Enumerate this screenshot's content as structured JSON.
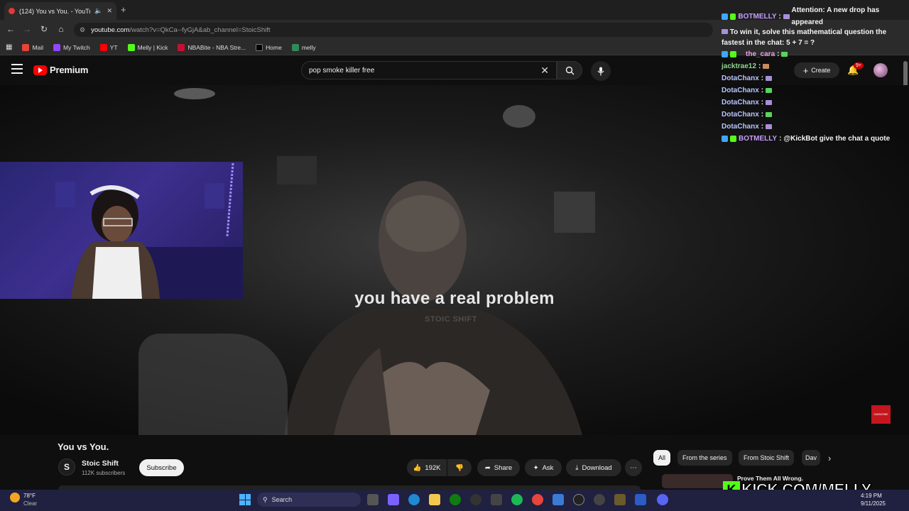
{
  "browser": {
    "tab_title": "(124) You vs You. - YouTube",
    "url_host": "youtube.com",
    "url_path": "/watch?v=QkCa--fyGjA&ab_channel=StoicShift",
    "bookmarks": [
      "Mail",
      "My Twitch",
      "YT",
      "Melly | Kick",
      "NBABite - NBA Stre...",
      "Home",
      "melly"
    ]
  },
  "youtube": {
    "logo_text": "Premium",
    "search_query": "pop smoke killer free",
    "create_label": "Create",
    "notif_count": "9+"
  },
  "video": {
    "caption": "you have a real problem",
    "watermark": "STOIC SHIFT",
    "subscribe_overlay": "SUBSCRIBE",
    "title": "You vs You.",
    "channel_initial": "S",
    "channel_name": "Stoic Shift",
    "subscribers": "112K subscribers",
    "subscribe_label": "Subscribe",
    "likes": "192K",
    "share_label": "Share",
    "ask_label": "Ask",
    "download_label": "Download"
  },
  "chips": [
    "All",
    "From the series",
    "From Stoic Shift",
    "Dav"
  ],
  "recommendation": {
    "title": "Prove Them All Wrong."
  },
  "chat": [
    {
      "user": "BOTMELLY",
      "text": "Attention: A new drop has appeared",
      "text2": "To win it, solve this mathematical question the fastest in the chat: 5 + 7 = ?"
    },
    {
      "user": "the_cara",
      "text": ""
    },
    {
      "user": "jacktrae12",
      "text": ""
    },
    {
      "user": "DotaChanx",
      "text": ""
    },
    {
      "user": "DotaChanx",
      "text": ""
    },
    {
      "user": "DotaChanx",
      "text": ""
    },
    {
      "user": "DotaChanx",
      "text": ""
    },
    {
      "user": "DotaChanx",
      "text": ""
    },
    {
      "user": "BOTMELLY",
      "text": "@KickBot give the chat a quote"
    }
  ],
  "kick_brand": {
    "k": "K",
    "text": "KICK.COM/MELLY"
  },
  "taskbar": {
    "temp": "78°F",
    "weather": "Clear",
    "search_label": "Search",
    "time": "4:19 PM",
    "date": "9/11/2025"
  },
  "colors": {
    "youtube_red": "#ff0000",
    "kick_green": "#53fc18",
    "bot_purple": "#c79bff"
  }
}
